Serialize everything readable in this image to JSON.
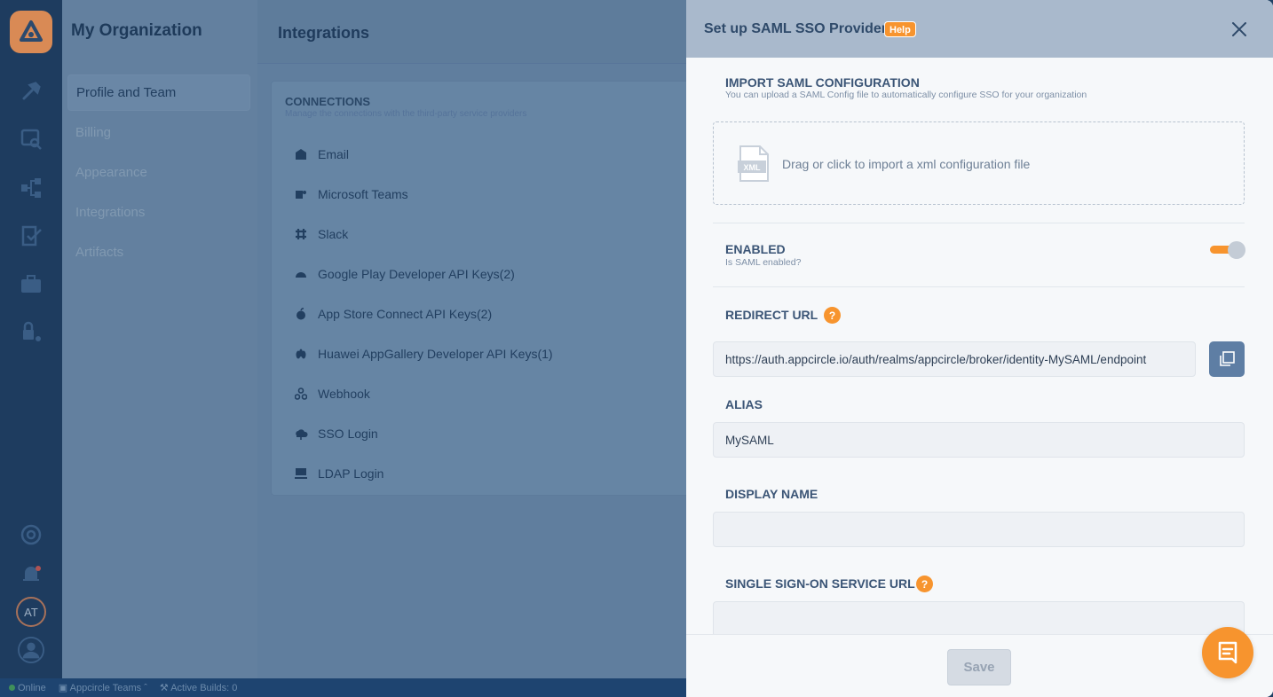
{
  "sidebar": {
    "avatar_initials": "AT"
  },
  "org": {
    "title": "My Organization",
    "menu": [
      {
        "label": "Profile and Team",
        "active": true
      },
      {
        "label": "Billing"
      },
      {
        "label": "Appearance"
      },
      {
        "label": "Integrations"
      },
      {
        "label": "Artifacts"
      }
    ]
  },
  "main": {
    "title": "Integrations",
    "connections": {
      "title": "CONNECTIONS",
      "subtitle": "Manage the connections with the third-party service providers",
      "items": [
        {
          "label": "Email",
          "icon": "email-icon"
        },
        {
          "label": "Microsoft Teams",
          "icon": "teams-icon"
        },
        {
          "label": "Slack",
          "icon": "slack-icon"
        },
        {
          "label": "Google Play Developer API Keys(2)",
          "icon": "android-icon"
        },
        {
          "label": "App Store Connect API Keys(2)",
          "icon": "apple-icon"
        },
        {
          "label": "Huawei AppGallery Developer API Keys(1)",
          "icon": "huawei-icon"
        },
        {
          "label": "Webhook",
          "icon": "webhook-icon"
        },
        {
          "label": "SSO Login",
          "icon": "cloud-icon"
        },
        {
          "label": "LDAP Login",
          "icon": "ldap-icon"
        }
      ]
    }
  },
  "statusbar": {
    "online": "Online",
    "team": "Appcircle Teams",
    "builds": "Active Builds: 0"
  },
  "drawer": {
    "title": "Set up SAML SSO Provider",
    "help_badge": "Help",
    "import": {
      "title": "IMPORT SAML CONFIGURATION",
      "subtitle": "You can upload a SAML Config file to automatically configure SSO for your organization",
      "dropzone_text": "Drag or click to import a xml configuration file",
      "file_badge": "XML"
    },
    "enabled": {
      "title": "ENABLED",
      "subtitle": "Is SAML enabled?",
      "value": true
    },
    "redirect_url": {
      "label": "REDIRECT URL",
      "value": "https://auth.appcircle.io/auth/realms/appcircle/broker/identity-MySAML/endpoint"
    },
    "alias": {
      "label": "ALIAS",
      "value": "MySAML"
    },
    "display_name": {
      "label": "DISPLAY NAME",
      "value": ""
    },
    "sso_url": {
      "label": "SINGLE SIGN-ON SERVICE URL",
      "value": ""
    },
    "save_label": "Save"
  },
  "colors": {
    "accent": "#f7942e",
    "drawer_header": "#a9b9cc",
    "copy_button": "#5e7ea4"
  }
}
